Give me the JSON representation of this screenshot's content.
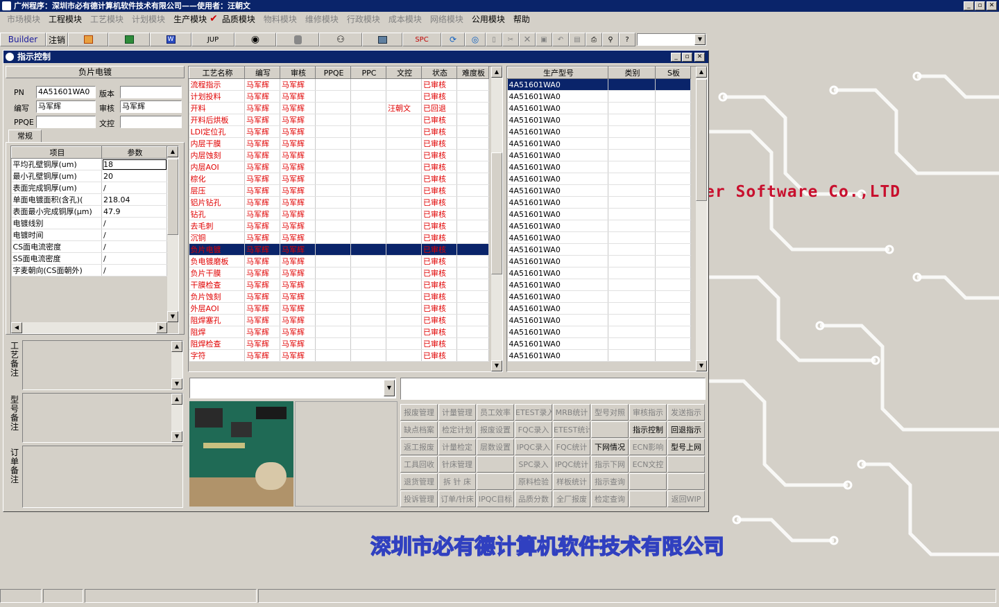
{
  "app_title": "广州程序：深圳市必有德计算机软件技术有限公司——使用者：汪朝文",
  "window_controls": {
    "min": "_",
    "max": "▫",
    "close": "✕"
  },
  "menu": [
    {
      "label": "市场模块",
      "enabled": false
    },
    {
      "label": "工程模块",
      "enabled": true
    },
    {
      "label": "工艺模块",
      "enabled": false
    },
    {
      "label": "计划模块",
      "enabled": false
    },
    {
      "label": "生产模块",
      "enabled": true
    },
    {
      "label": "品质模块",
      "enabled": true
    },
    {
      "label": "物料模块",
      "enabled": false
    },
    {
      "label": "维修模块",
      "enabled": false
    },
    {
      "label": "行政模块",
      "enabled": false
    },
    {
      "label": "成本模块",
      "enabled": false
    },
    {
      "label": "网络模块",
      "enabled": false
    },
    {
      "label": "公用模块",
      "enabled": true
    },
    {
      "label": "帮助",
      "enabled": true
    }
  ],
  "toolbar": {
    "builder": "Builder",
    "logout": "注销",
    "jup": "JUP",
    "spc": "SPC"
  },
  "window": {
    "title": "指示控制"
  },
  "left": {
    "section_title": "负片电镀",
    "pn_label": "PN",
    "pn_value": "4A51601WA0",
    "version_label": "版本",
    "version_value": "",
    "compile_label": "编写",
    "compile_value": "马军辉",
    "review_label": "审核",
    "review_value": "马军辉",
    "ppqe_label": "PPQE",
    "ppqe_value": "",
    "wenkong_label": "文控",
    "wenkong_value": "",
    "tab_label": "常规",
    "param_headers": [
      "项目",
      "参数"
    ],
    "params": [
      {
        "item": "平均孔壁铜厚(um)",
        "value": "18"
      },
      {
        "item": "最小孔壁铜厚(um)",
        "value": "20"
      },
      {
        "item": "表面完成铜厚(um)",
        "value": "/"
      },
      {
        "item": "单面电镀面积(含孔)(",
        "value": "218.04"
      },
      {
        "item": "表面最小完成铜厚(μm)",
        "value": "47.9"
      },
      {
        "item": "电镀线别",
        "value": "/"
      },
      {
        "item": "电镀时间",
        "value": "/"
      },
      {
        "item": "CS面电流密度",
        "value": "/"
      },
      {
        "item": "SS面电流密度",
        "value": "/"
      },
      {
        "item": "字麦朝向(CS面朝外)",
        "value": "/"
      }
    ],
    "note_labels": [
      "工艺备注",
      "型号备注",
      "订单备注"
    ]
  },
  "process": {
    "headers": [
      "工艺名称",
      "编写",
      "审核",
      "PPQE",
      "PPC",
      "文控",
      "状态",
      "难度板"
    ],
    "rows": [
      {
        "name": "流程指示",
        "w": "马军辉",
        "s": "马军辉",
        "ppqe": "",
        "ppc": "",
        "wk": "",
        "st": "已审核",
        "nd": ""
      },
      {
        "name": "计划投料",
        "w": "马军辉",
        "s": "马军辉",
        "ppqe": "",
        "ppc": "",
        "wk": "",
        "st": "已审核",
        "nd": ""
      },
      {
        "name": "开料",
        "w": "马军辉",
        "s": "马军辉",
        "ppqe": "",
        "ppc": "",
        "wk": "汪朝文",
        "st": "已回退",
        "nd": ""
      },
      {
        "name": "开料后烘板",
        "w": "马军辉",
        "s": "马军辉",
        "ppqe": "",
        "ppc": "",
        "wk": "",
        "st": "已审核",
        "nd": ""
      },
      {
        "name": "LDI定位孔",
        "w": "马军辉",
        "s": "马军辉",
        "ppqe": "",
        "ppc": "",
        "wk": "",
        "st": "已审核",
        "nd": ""
      },
      {
        "name": "内层干膜",
        "w": "马军辉",
        "s": "马军辉",
        "ppqe": "",
        "ppc": "",
        "wk": "",
        "st": "已审核",
        "nd": ""
      },
      {
        "name": "内层蚀刻",
        "w": "马军辉",
        "s": "马军辉",
        "ppqe": "",
        "ppc": "",
        "wk": "",
        "st": "已审核",
        "nd": ""
      },
      {
        "name": "内层AOI",
        "w": "马军辉",
        "s": "马军辉",
        "ppqe": "",
        "ppc": "",
        "wk": "",
        "st": "已审核",
        "nd": ""
      },
      {
        "name": "棕化",
        "w": "马军辉",
        "s": "马军辉",
        "ppqe": "",
        "ppc": "",
        "wk": "",
        "st": "已审核",
        "nd": ""
      },
      {
        "name": "层压",
        "w": "马军辉",
        "s": "马军辉",
        "ppqe": "",
        "ppc": "",
        "wk": "",
        "st": "已审核",
        "nd": ""
      },
      {
        "name": "铝片钻孔",
        "w": "马军辉",
        "s": "马军辉",
        "ppqe": "",
        "ppc": "",
        "wk": "",
        "st": "已审核",
        "nd": ""
      },
      {
        "name": "钻孔",
        "w": "马军辉",
        "s": "马军辉",
        "ppqe": "",
        "ppc": "",
        "wk": "",
        "st": "已审核",
        "nd": ""
      },
      {
        "name": "去毛刺",
        "w": "马军辉",
        "s": "马军辉",
        "ppqe": "",
        "ppc": "",
        "wk": "",
        "st": "已审核",
        "nd": ""
      },
      {
        "name": "沉铜",
        "w": "马军辉",
        "s": "马军辉",
        "ppqe": "",
        "ppc": "",
        "wk": "",
        "st": "已审核",
        "nd": ""
      },
      {
        "name": "负片电镀",
        "w": "马军辉",
        "s": "马军辉",
        "ppqe": "",
        "ppc": "",
        "wk": "",
        "st": "已审核",
        "nd": ""
      },
      {
        "name": "负电镀磨板",
        "w": "马军辉",
        "s": "马军辉",
        "ppqe": "",
        "ppc": "",
        "wk": "",
        "st": "已审核",
        "nd": ""
      },
      {
        "name": "负片干膜",
        "w": "马军辉",
        "s": "马军辉",
        "ppqe": "",
        "ppc": "",
        "wk": "",
        "st": "已审核",
        "nd": ""
      },
      {
        "name": "干膜检查",
        "w": "马军辉",
        "s": "马军辉",
        "ppqe": "",
        "ppc": "",
        "wk": "",
        "st": "已审核",
        "nd": ""
      },
      {
        "name": "负片蚀刻",
        "w": "马军辉",
        "s": "马军辉",
        "ppqe": "",
        "ppc": "",
        "wk": "",
        "st": "已审核",
        "nd": ""
      },
      {
        "name": "外层AOI",
        "w": "马军辉",
        "s": "马军辉",
        "ppqe": "",
        "ppc": "",
        "wk": "",
        "st": "已审核",
        "nd": ""
      },
      {
        "name": "阻焊塞孔",
        "w": "马军辉",
        "s": "马军辉",
        "ppqe": "",
        "ppc": "",
        "wk": "",
        "st": "已审核",
        "nd": ""
      },
      {
        "name": "阻焊",
        "w": "马军辉",
        "s": "马军辉",
        "ppqe": "",
        "ppc": "",
        "wk": "",
        "st": "已审核",
        "nd": ""
      },
      {
        "name": "阻焊检查",
        "w": "马军辉",
        "s": "马军辉",
        "ppqe": "",
        "ppc": "",
        "wk": "",
        "st": "已审核",
        "nd": ""
      },
      {
        "name": "字符",
        "w": "马军辉",
        "s": "马军辉",
        "ppqe": "",
        "ppc": "",
        "wk": "",
        "st": "已审核",
        "nd": ""
      }
    ],
    "selected_index": 14
  },
  "models": {
    "headers": [
      "生产型号",
      "类别",
      "S板"
    ],
    "rows": [
      "4A51601WA0",
      "4A51601WA0",
      "4A51601WA0",
      "4A51601WA0",
      "4A51601WA0",
      "4A51601WA0",
      "4A51601WA0",
      "4A51601WA0",
      "4A51601WA0",
      "4A51601WA0",
      "4A51601WA0",
      "4A51601WA0",
      "4A51601WA0",
      "4A51601WA0",
      "4A51601WA0",
      "4A51601WA0",
      "4A51601WA0",
      "4A51601WA0",
      "4A51601WA0",
      "4A51601WA0",
      "4A51601WA0",
      "4A51601WA0",
      "4A51601WA0",
      "4A51601WA0"
    ]
  },
  "functions": [
    [
      {
        "t": "报废管理",
        "e": false
      },
      {
        "t": "计量管理",
        "e": false
      },
      {
        "t": "员工效率",
        "e": false
      },
      {
        "t": "ETEST录入",
        "e": false
      },
      {
        "t": "MRB统计",
        "e": false
      },
      {
        "t": "型号对照",
        "e": false
      },
      {
        "t": "审核指示",
        "e": false
      },
      {
        "t": "发送指示",
        "e": false
      }
    ],
    [
      {
        "t": "缺点档案",
        "e": false
      },
      {
        "t": "检定计划",
        "e": false
      },
      {
        "t": "报废设置",
        "e": false
      },
      {
        "t": "FQC录入",
        "e": false
      },
      {
        "t": "ETEST统计",
        "e": false
      },
      {
        "t": "",
        "e": false
      },
      {
        "t": "指示控制",
        "e": true
      },
      {
        "t": "回退指示",
        "e": true
      }
    ],
    [
      {
        "t": "返工报废",
        "e": false
      },
      {
        "t": "计量检定",
        "e": false
      },
      {
        "t": "层数设置",
        "e": false
      },
      {
        "t": "IPQC录入",
        "e": false
      },
      {
        "t": "FQC统计",
        "e": false
      },
      {
        "t": "下网情况",
        "e": true
      },
      {
        "t": "ECN影响",
        "e": false
      },
      {
        "t": "型号上网",
        "e": true
      }
    ],
    [
      {
        "t": "工具回收",
        "e": false
      },
      {
        "t": "针床管理",
        "e": false
      },
      {
        "t": "",
        "e": false
      },
      {
        "t": "SPC录入",
        "e": false
      },
      {
        "t": "IPQC统计",
        "e": false
      },
      {
        "t": "指示下网",
        "e": false
      },
      {
        "t": "ECN文控",
        "e": false
      },
      {
        "t": "",
        "e": false
      }
    ],
    [
      {
        "t": "退货管理",
        "e": false
      },
      {
        "t": "拆 针 床",
        "e": false
      },
      {
        "t": "",
        "e": false
      },
      {
        "t": "原料检验",
        "e": false
      },
      {
        "t": "样板统计",
        "e": false
      },
      {
        "t": "指示查询",
        "e": false
      },
      {
        "t": "",
        "e": false
      },
      {
        "t": "",
        "e": false
      }
    ],
    [
      {
        "t": "投诉管理",
        "e": false
      },
      {
        "t": "订单/针床",
        "e": false
      },
      {
        "t": "IPQC目标",
        "e": false
      },
      {
        "t": "品质分数",
        "e": false
      },
      {
        "t": "全厂报废",
        "e": false
      },
      {
        "t": "检定查询",
        "e": false
      },
      {
        "t": "",
        "e": false
      },
      {
        "t": "返回WIP",
        "e": false
      }
    ]
  ],
  "banner": {
    "software_text": "er Software Co.,LTD",
    "company_text": "深圳市必有德计算机软件技术有限公司"
  },
  "colors": {
    "title_bg": "#0a246a",
    "selected_row": "#0a246a",
    "text_red": "#e00000",
    "banner_red": "#c8102e",
    "banner_blue": "#3040c0"
  }
}
